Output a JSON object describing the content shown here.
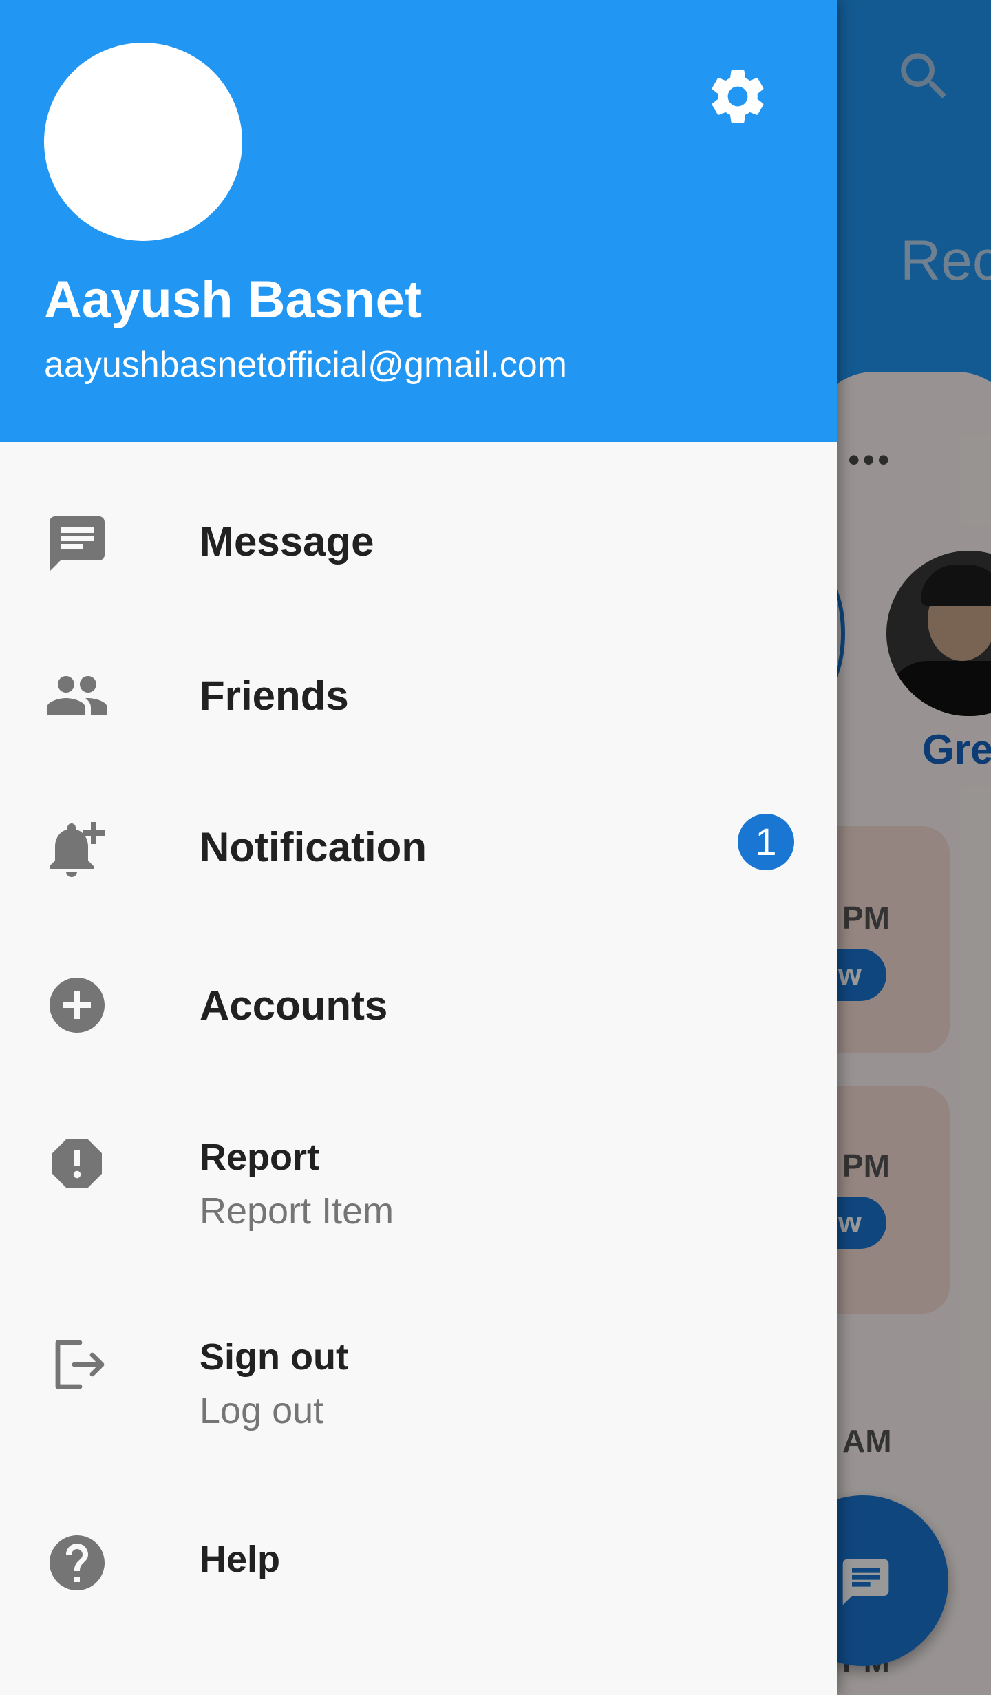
{
  "drawer": {
    "user": {
      "name": "Aayush Basnet",
      "email": "aayushbasnetofficial@gmail.com"
    },
    "header_color": "#2196f3",
    "settings_icon": "gear-icon",
    "items": [
      {
        "icon": "message-icon",
        "label": "Message"
      },
      {
        "icon": "friends-icon",
        "label": "Friends"
      },
      {
        "icon": "notification-add-icon",
        "label": "Notification",
        "badge": "1"
      },
      {
        "icon": "add-circle-icon",
        "label": "Accounts"
      },
      {
        "icon": "report-icon",
        "label": "Report",
        "subtitle": "Report Item"
      },
      {
        "icon": "sign-out-icon",
        "label": "Sign out",
        "subtitle": "Log out"
      },
      {
        "icon": "help-icon",
        "label": "Help"
      }
    ]
  },
  "background_app": {
    "title_fragment": "Rec",
    "dots": "•••",
    "story_name_fragment": "Gre",
    "cards": [
      {
        "time_fragment": "PM",
        "pill_fragment": "w"
      },
      {
        "time_fragment": "PM",
        "pill_fragment": "w"
      }
    ],
    "times": [
      "AM",
      "PM"
    ],
    "accent_color": "#1976d2"
  }
}
